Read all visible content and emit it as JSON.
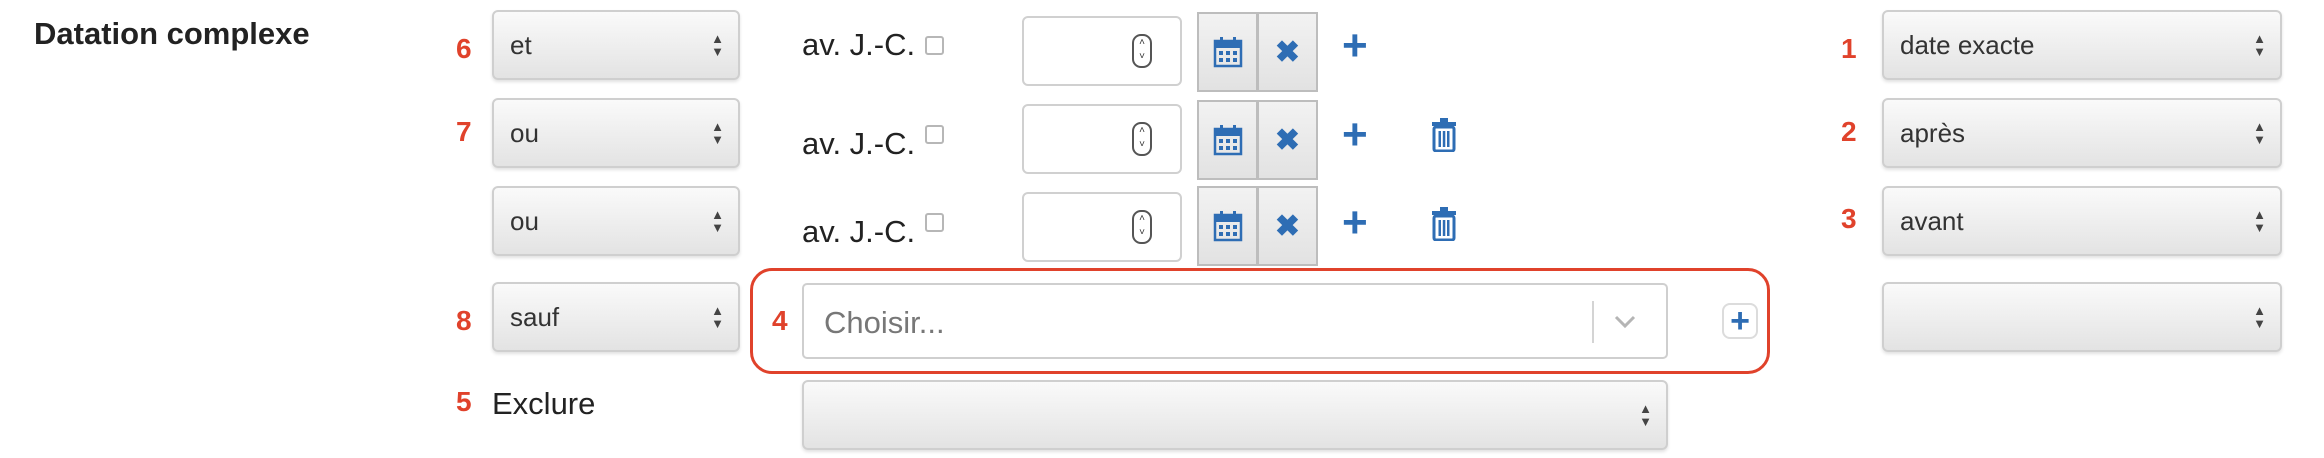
{
  "section_title": "Datation complexe",
  "markers": {
    "m1": "1",
    "m2": "2",
    "m3": "3",
    "m4": "4",
    "m5": "5",
    "m6": "6",
    "m7": "7",
    "m8": "8"
  },
  "rows": [
    {
      "operator": "et",
      "bc_label": "av. J.-C.",
      "year_value": "",
      "qualifier": "date exacte"
    },
    {
      "operator": "ou",
      "bc_label": "av. J.-C.",
      "year_value": "",
      "qualifier": "après"
    },
    {
      "operator": "ou",
      "bc_label": "av. J.-C.",
      "year_value": "",
      "qualifier": "avant"
    }
  ],
  "sauf": {
    "operator": "sauf",
    "combo_placeholder": "Choisir...",
    "qualifier": ""
  },
  "exclure": {
    "label": "Exclure",
    "value": ""
  },
  "icons": {
    "select_arrows": "up-down-arrows-icon",
    "calendar": "calendar-icon",
    "clear": "close-icon",
    "add": "plus-icon",
    "delete": "trash-icon",
    "chevron": "chevron-down-icon",
    "spinner": "number-spinner-icon"
  },
  "colors": {
    "accent": "#2e6db4",
    "marker": "#e0422b",
    "border": "#cfcfcf",
    "title": "#222222"
  }
}
